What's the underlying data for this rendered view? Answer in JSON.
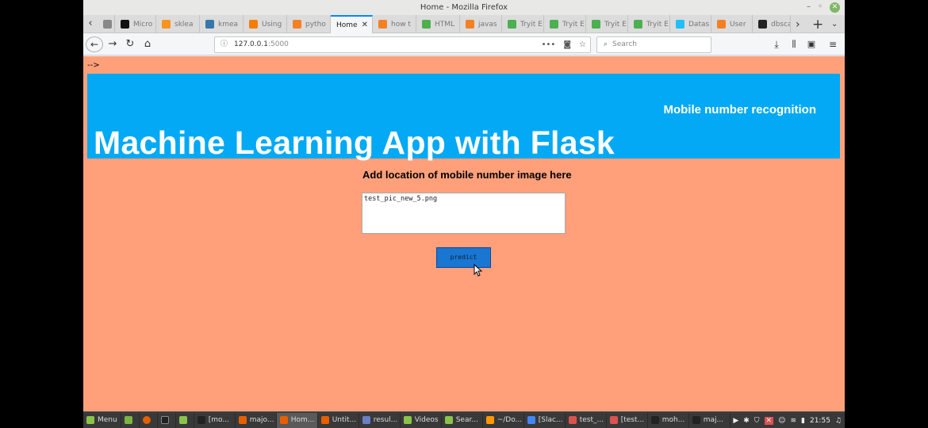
{
  "window": {
    "title": "Home - Mozilla Firefox",
    "minimize": "–",
    "restore": "◦",
    "close": "✕"
  },
  "tabs": [
    {
      "label": "",
      "icon": "tab-favicon",
      "color": "#888"
    },
    {
      "label": "Micro",
      "icon": "medium-icon",
      "color": "#111"
    },
    {
      "label": "sklea",
      "icon": "sklearn-icon",
      "color": "#f7931e"
    },
    {
      "label": "kmea",
      "icon": "python-icon",
      "color": "#3776ab"
    },
    {
      "label": "Using",
      "icon": "blogger-icon",
      "color": "#f57d00"
    },
    {
      "label": "pytho",
      "icon": "stackoverflow-icon",
      "color": "#f48024"
    },
    {
      "label": "Home",
      "icon": "",
      "color": "",
      "active": true
    },
    {
      "label": "how t",
      "icon": "stackoverflow-icon",
      "color": "#f48024"
    },
    {
      "label": "HTML",
      "icon": "w3schools-icon",
      "color": "#4caf50"
    },
    {
      "label": "javas",
      "icon": "stackoverflow-icon",
      "color": "#f48024"
    },
    {
      "label": "Tryit E",
      "icon": "w3schools-icon",
      "color": "#4caf50"
    },
    {
      "label": "Tryit E",
      "icon": "w3schools-icon",
      "color": "#4caf50"
    },
    {
      "label": "Tryit E",
      "icon": "w3schools-icon",
      "color": "#4caf50"
    },
    {
      "label": "Tryit E",
      "icon": "w3schools-icon",
      "color": "#4caf50"
    },
    {
      "label": "Datas",
      "icon": "kaggle-icon",
      "color": "#20beff"
    },
    {
      "label": "User",
      "icon": "stackoverflow-icon",
      "color": "#f48024"
    },
    {
      "label": "dbsca",
      "icon": "github-icon",
      "color": "#222"
    }
  ],
  "nav": {
    "url_host": "127.0.0.1",
    "url_port": ":5000",
    "search_placeholder": "Search"
  },
  "page": {
    "stray_text": "-->",
    "subtitle": "Mobile number recognition",
    "title": "Machine Learning App with Flask",
    "form_label": "Add location of mobile number image here",
    "input_value": "test_pic_new_5.png",
    "button_label": "predict",
    "banner_color": "#03a9f4",
    "background_color": "#ffa07a",
    "button_color": "#1976d2"
  },
  "taskbar": {
    "menu_label": "Menu",
    "items": [
      {
        "label": "[mo...",
        "icon": "terminal-icon",
        "color": "#222"
      },
      {
        "label": "majo...",
        "icon": "firefox-icon",
        "color": "#e66000"
      },
      {
        "label": "Hom...",
        "icon": "firefox-icon",
        "color": "#e66000",
        "active": true
      },
      {
        "label": "Untit...",
        "icon": "firefox-icon",
        "color": "#e66000"
      },
      {
        "label": "resul...",
        "icon": "text-editor-icon",
        "color": "#6a7fc4"
      },
      {
        "label": "Videos",
        "icon": "folder-icon",
        "color": "#8bc34a"
      },
      {
        "label": "Sear...",
        "icon": "folder-icon",
        "color": "#8bc34a"
      },
      {
        "label": "~/Do...",
        "icon": "sublime-icon",
        "color": "#ff9800"
      },
      {
        "label": "[Slac...",
        "icon": "chrome-icon",
        "color": "#4285f4"
      },
      {
        "label": "test_...",
        "icon": "image-viewer-icon",
        "color": "#d9534f"
      },
      {
        "label": "[test...",
        "icon": "image-viewer-icon",
        "color": "#d9534f"
      },
      {
        "label": "moh...",
        "icon": "terminal-icon",
        "color": "#222"
      },
      {
        "label": "maj...",
        "icon": "terminal-icon",
        "color": "#222"
      }
    ],
    "clock": "21:55"
  }
}
